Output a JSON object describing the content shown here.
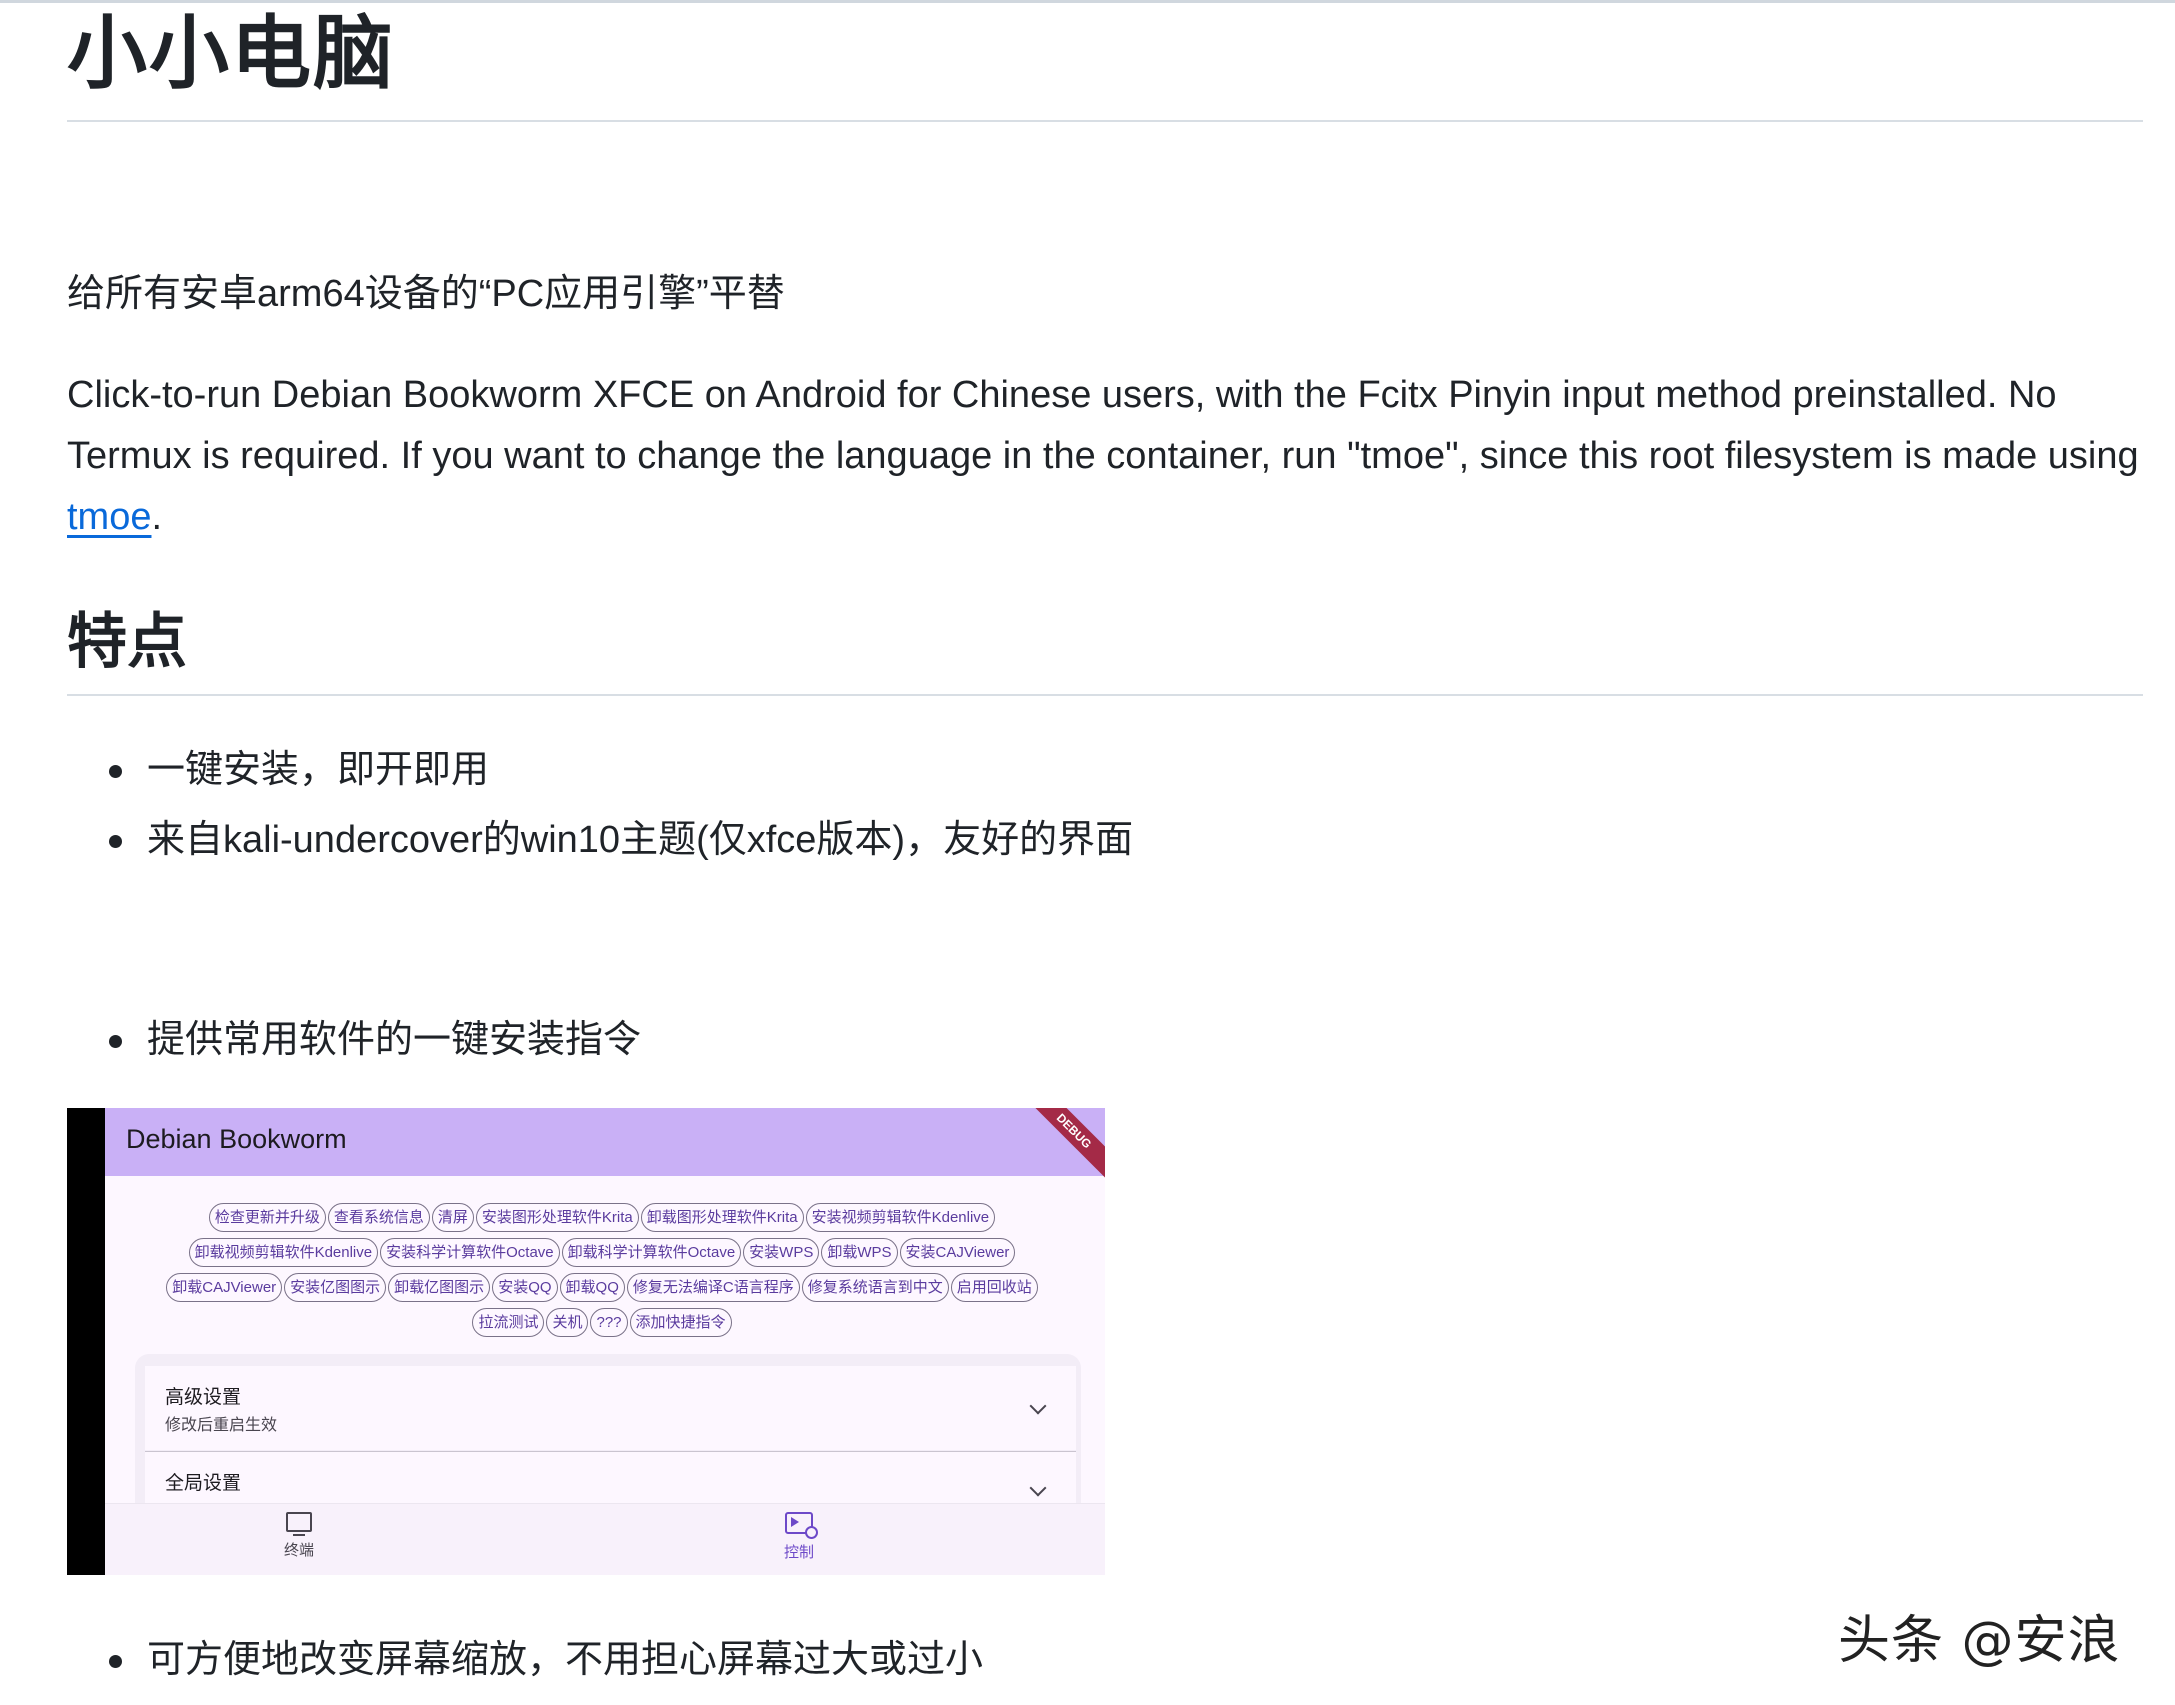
{
  "doc": {
    "title": "小小电脑",
    "intro_zh": "给所有安卓arm64设备的“PC应用引擎”平替",
    "intro_en_before_link": "Click-to-run Debian Bookworm XFCE on Android for Chinese users, with the Fcitx Pinyin input method preinstalled. No Termux is required. If you want to change the language in the container, run \"tmoe\", since this root filesystem is made using ",
    "intro_en_link": "tmoe",
    "intro_en_after_link": ".",
    "features_heading": "特点",
    "features": [
      "一键安装，即开即用",
      "来自kali-undercover的win10主题(仅xfce版本)，友好的界面",
      "提供常用软件的一键安装指令",
      "可方便地改变屏幕缩放，不用担心屏幕过大或过小"
    ]
  },
  "app_screenshot": {
    "app_title": "Debian Bookworm",
    "debug_banner": "DEBUG",
    "chip_rows": [
      [
        "检查更新并升级",
        "查看系统信息",
        "清屏",
        "安装图形处理软件Krita",
        "卸载图形处理软件Krita",
        "安装视频剪辑软件Kdenlive"
      ],
      [
        "卸载视频剪辑软件Kdenlive",
        "安装科学计算软件Octave",
        "卸载科学计算软件Octave",
        "安装WPS",
        "卸载WPS",
        "安装CAJViewer"
      ],
      [
        "卸载CAJViewer",
        "安装亿图图示",
        "卸载亿图图示",
        "安装QQ",
        "卸载QQ",
        "修复无法编译C语言程序",
        "修复系统语言到中文",
        "启用回收站"
      ],
      [
        "拉流测试",
        "关机",
        "???",
        "添加快捷指令"
      ]
    ],
    "settings": [
      {
        "title": "高级设置",
        "subtitle": "修改后重启生效"
      },
      {
        "title": "全局设置",
        "subtitle": ""
      }
    ],
    "nav": [
      {
        "label": "终端",
        "icon": "monitor-icon"
      },
      {
        "label": "控制",
        "icon": "control-icon"
      }
    ],
    "colors": {
      "appbar": "#c9b0f6",
      "debug": "#a42a47",
      "nav_active": "#6d49c8"
    }
  },
  "watermark": "头条 @安浪"
}
